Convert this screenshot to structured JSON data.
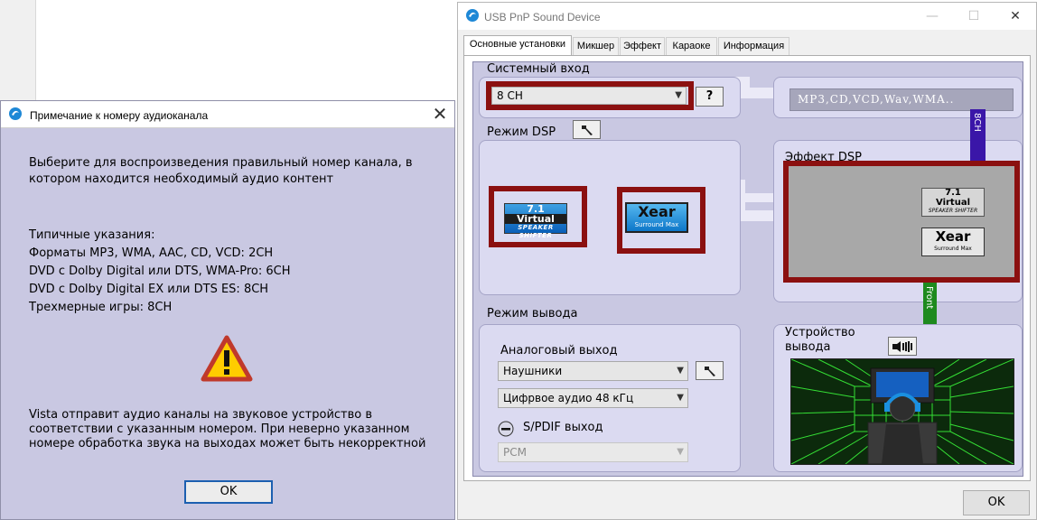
{
  "note_dialog": {
    "title": "Примечание к номеру аудиоканала",
    "paragraph1": "Выберите для воспроизведения правильный номер канала, в котором находится необходимый аудио контент",
    "typical_heading": "Типичные указания:",
    "typical_lines": [
      "Форматы MP3, WMA, AAC, CD, VCD: 2CH",
      "DVD с Dolby Digital или DTS, WMA-Pro: 6CH",
      "DVD с Dolby Digital EX или DTS ES: 8CH",
      "Трехмерные игры: 8CH"
    ],
    "paragraph2": "Vista отправит аудио каналы на звуковое устройство в соответствии с указанным номером. При неверно указанном номере обработка звука на выходах может быть некорректной",
    "ok_label": "OK",
    "close_glyph": "✕",
    "warning_icon": "warning-icon"
  },
  "main_window": {
    "title": "USB PnP Sound Device",
    "minimize_glyph": "—",
    "maximize_glyph": "☐",
    "close_glyph": "✕",
    "tabs": [
      {
        "label": "Основные установки",
        "active": true
      },
      {
        "label": "Микшер",
        "active": false
      },
      {
        "label": "Эффект",
        "active": false
      },
      {
        "label": "Караоке",
        "active": false
      },
      {
        "label": "Информация",
        "active": false
      }
    ],
    "system_input": {
      "label": "Системный вход",
      "selected": "8 CH",
      "help_label": "?",
      "source_text": "MP3,CD,VCD,Wav,WMA.."
    },
    "dsp_mode": {
      "label": "Режим DSP",
      "logo_71": {
        "number": "7.1",
        "word": "Virtual",
        "sub": "SPEAKER SHIFTER"
      },
      "logo_xear": {
        "word": "Xear",
        "sub": "Surround Max"
      }
    },
    "dsp_effect": {
      "label": "Эффект DSP",
      "tag_8ch": "8CH",
      "tag_front": "Front"
    },
    "output_mode": {
      "label": "Режим вывода",
      "analog_label": "Аналоговый выход",
      "analog_selected": "Наушники",
      "digital_selected": "Цифрвое аудио 48 кГц",
      "spdif_label": "S/PDIF выход",
      "spdif_selected": "PCM"
    },
    "output_device": {
      "label_line1": "Устройство",
      "label_line2": "вывода"
    },
    "ok_label": "OK"
  },
  "colors": {
    "panel": "#c9c8e2",
    "accent_red": "#8b1010",
    "tag_purple": "#3a16a8",
    "tag_green": "#1e8a1e"
  }
}
